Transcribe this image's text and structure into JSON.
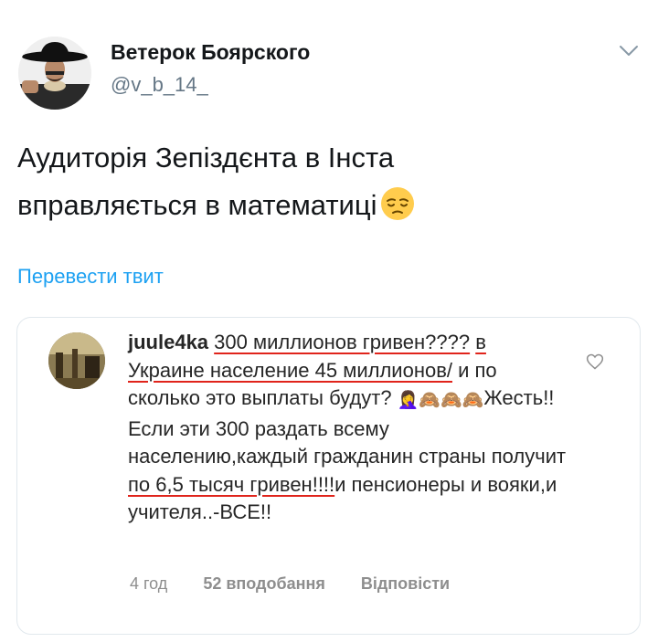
{
  "tweet": {
    "author_name": "Ветерок Боярского",
    "author_handle": "@v_b_14_",
    "text_line1": "Аудиторія Зепіздєнта в Інста",
    "text_line2": "вправляється в математиці",
    "emoji": "pensive-face",
    "translate_label": "Перевести твит"
  },
  "quote": {
    "username": "juule4ka",
    "seg1": "300 миллионов гривен????",
    "seg2": "в Украине население 45 миллионов/",
    "seg3": " и по сколько это  выплаты будут?",
    "faces": "🤦‍♀️🙈🙈🙈",
    "seg4": "Жесть!!Если эти 300 раздать всему населению,каждый гражданин страны получит ",
    "seg5": "по 6,5 тысяч гривен!!!!",
    "seg6": "и пенсионеры и вояки,и учителя..-ВСЕ!!",
    "time": "4 год",
    "likes": "52 вподобання",
    "reply": "Відповісти"
  },
  "colors": {
    "translate": "#1da1f2",
    "underline": "#e0241b",
    "meta": "#8e8e8e"
  }
}
